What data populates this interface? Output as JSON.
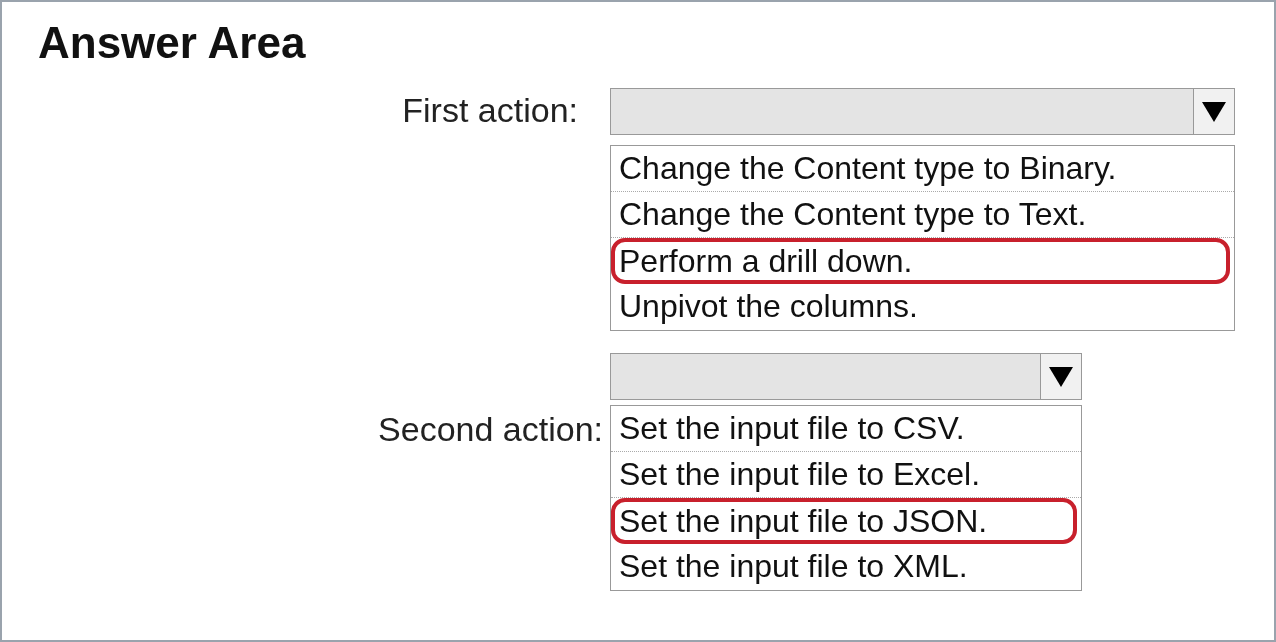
{
  "title": "Answer Area",
  "dropdowns": [
    {
      "label": "First action:",
      "options": [
        {
          "text": "Change the Content type to Binary.",
          "selected": false
        },
        {
          "text": "Change the Content type to Text.",
          "selected": false
        },
        {
          "text": "Perform a drill down.",
          "selected": true
        },
        {
          "text": "Unpivot the columns.",
          "selected": false
        }
      ]
    },
    {
      "label": "Second action:",
      "options": [
        {
          "text": "Set the input file to CSV.",
          "selected": false
        },
        {
          "text": "Set the input file to Excel.",
          "selected": false
        },
        {
          "text": "Set the input file to JSON.",
          "selected": true
        },
        {
          "text": "Set the input file to XML.",
          "selected": false
        }
      ]
    }
  ]
}
